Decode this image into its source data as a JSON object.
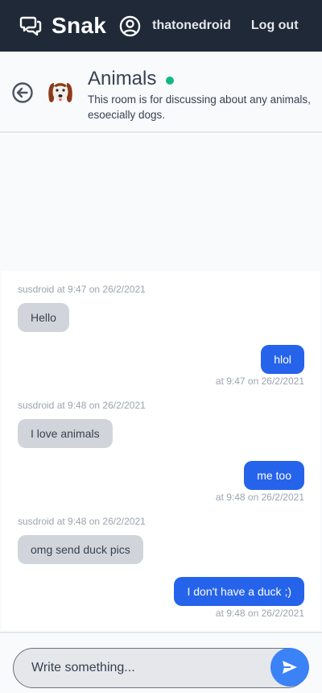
{
  "navbar": {
    "brand": "Snak",
    "username": "thatonedroid",
    "logout_label": "Log out"
  },
  "room": {
    "name": "Animals",
    "online": true,
    "description": "This room is for discussing about any animals, esoecially dogs."
  },
  "messages": [
    {
      "direction": "incoming",
      "meta": "susdroid at 9:47 on 26/2/2021",
      "text": "Hello"
    },
    {
      "direction": "outgoing",
      "meta": "at 9:47 on 26/2/2021",
      "text": "hlol"
    },
    {
      "direction": "incoming",
      "meta": "susdroid at 9:48 on 26/2/2021",
      "text": "I love animals"
    },
    {
      "direction": "outgoing",
      "meta": "at 9:48 on 26/2/2021",
      "text": "me too"
    },
    {
      "direction": "incoming",
      "meta": "susdroid at 9:48 on 26/2/2021",
      "text": "omg send duck pics"
    },
    {
      "direction": "outgoing",
      "meta": "at 9:48 on 26/2/2021",
      "text": "I don't have a duck ;)"
    }
  ],
  "composer": {
    "placeholder": "Write something...",
    "value": ""
  },
  "icons": {
    "brand": "chat-bubbles-icon",
    "user": "user-circle-icon",
    "back": "arrow-left-circle-icon",
    "room_avatar": "dog-icon",
    "send": "send-icon"
  },
  "colors": {
    "navbar": "#1f2937",
    "outgoing_bubble": "#2563eb",
    "incoming_bubble": "#d1d5db",
    "online": "#10b981",
    "send_button": "#3b82f6"
  }
}
